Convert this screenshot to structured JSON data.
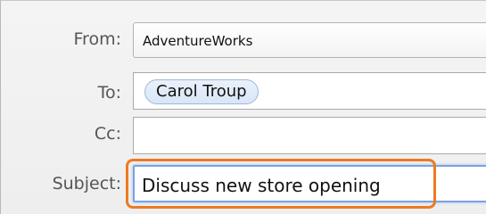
{
  "header": {
    "from": {
      "label": "From:",
      "value": "AdventureWorks"
    },
    "to": {
      "label": "To:",
      "recipients": [
        "Carol Troup"
      ]
    },
    "cc": {
      "label": "Cc:",
      "value": ""
    },
    "subject": {
      "label": "Subject:",
      "value": "Discuss new store opening"
    }
  },
  "colors": {
    "highlight": "#ee7a22",
    "focus_ring": "#7aa4df",
    "token_border": "#9eb8d9"
  }
}
